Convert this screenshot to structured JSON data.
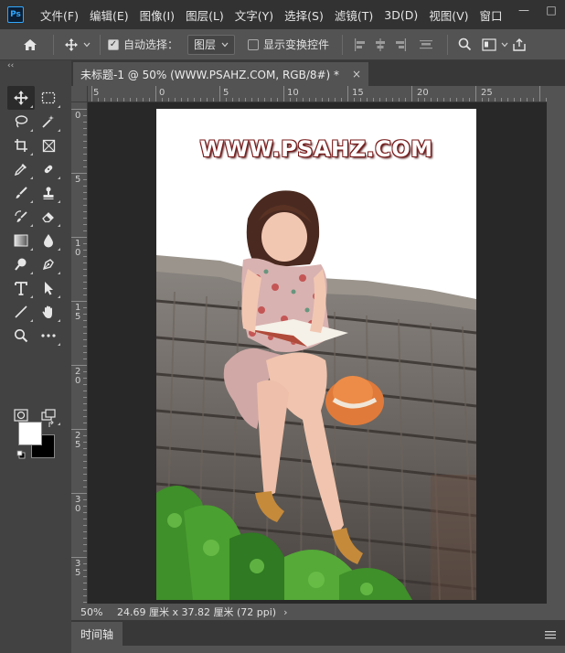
{
  "app": {
    "logo": "Ps"
  },
  "menu": [
    "文件(F)",
    "编辑(E)",
    "图像(I)",
    "图层(L)",
    "文字(Y)",
    "选择(S)",
    "滤镜(T)",
    "3D(D)",
    "视图(V)",
    "窗口"
  ],
  "window_controls": {
    "minimize": "—",
    "maximize": "□"
  },
  "options": {
    "auto_select_label": "自动选择：",
    "auto_select_checked": true,
    "layer_select_value": "图层",
    "show_transform_label": "显示变换控件",
    "show_transform_checked": false
  },
  "tools_collapse": "‹‹",
  "document": {
    "tab_title": "未标题-1 @ 50% (WWW.PSAHZ.COM, RGB/8#) *",
    "tab_close": "×",
    "watermark": "WWW.PSAHZ.COM"
  },
  "ruler": {
    "h_labels": [
      "5",
      "0",
      "5",
      "10",
      "15",
      "20",
      "25"
    ],
    "v_labels": [
      "0",
      "5",
      "1\n0",
      "1\n5",
      "2\n0",
      "2\n5",
      "3\n0",
      "3\n5"
    ]
  },
  "status": {
    "zoom": "50%",
    "doc_size": "24.69 厘米 x 37.82 厘米 (72 ppi)",
    "arrow": "›"
  },
  "timeline": {
    "tab_label": "时间轴"
  },
  "colors": {
    "foreground": "#ffffff",
    "background": "#000000",
    "accent": "#31a8ff",
    "watermark_outline": "#7a1c1c"
  }
}
